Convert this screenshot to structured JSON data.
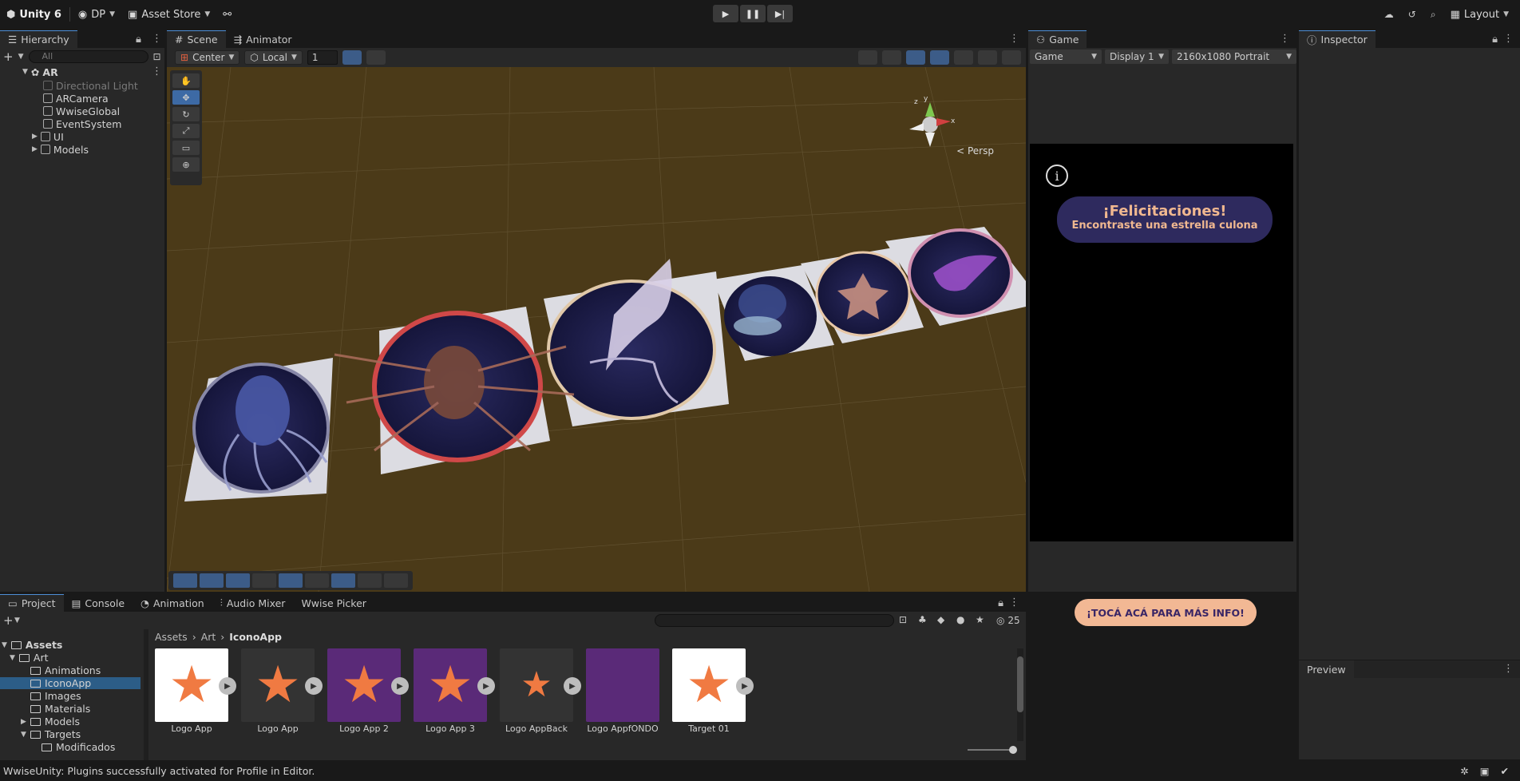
{
  "toolbar": {
    "app_name": "Unity 6",
    "account": "DP",
    "asset_store": "Asset Store",
    "layout": "Layout"
  },
  "hierarchy": {
    "tab": "Hierarchy",
    "search_placeholder": "All",
    "root": "AR",
    "items": [
      "Directional Light",
      "ARCamera",
      "WwiseGlobal",
      "EventSystem",
      "UI",
      "Models"
    ]
  },
  "scene": {
    "tabs": [
      "Scene",
      "Animator"
    ],
    "pivot": "Center",
    "space": "Local",
    "snap_value": "1",
    "persp_label": "< Persp"
  },
  "game": {
    "tab": "Game",
    "mode": "Game",
    "display": "Display 1",
    "resolution": "2160x1080 Portrait",
    "info_icon": "i",
    "congrats_title": "¡Felicitaciones!",
    "congrats_sub": "Encontraste una estrella culona",
    "cta": "¡TOCÁ ACÁ PARA MÁS INFO!"
  },
  "inspector": {
    "tab": "Inspector"
  },
  "preview": {
    "tab": "Preview"
  },
  "project": {
    "tabs": [
      "Project",
      "Console",
      "Animation",
      "Audio Mixer",
      "Wwise Picker"
    ],
    "count": "25",
    "tree": [
      "Assets",
      "Art",
      "Animations",
      "IconoApp",
      "Images",
      "Materials",
      "Models",
      "Targets",
      "Modificados"
    ],
    "breadcrumb": [
      "Assets",
      "Art",
      "IconoApp"
    ],
    "assets": [
      {
        "label": "Logo App",
        "bg": "#ffffff"
      },
      {
        "label": "Logo App",
        "bg": "#333333"
      },
      {
        "label": "Logo App 2",
        "bg": "#5a2a78"
      },
      {
        "label": "Logo App 3",
        "bg": "#5a2a78"
      },
      {
        "label": "Logo AppBack",
        "bg": "#333333"
      },
      {
        "label": "Logo AppfONDO",
        "bg": "#5a2a78"
      },
      {
        "label": "Target 01",
        "bg": "#ffffff"
      }
    ]
  },
  "status": {
    "message": "WwiseUnity: Plugins successfully activated for Profile in Editor."
  }
}
